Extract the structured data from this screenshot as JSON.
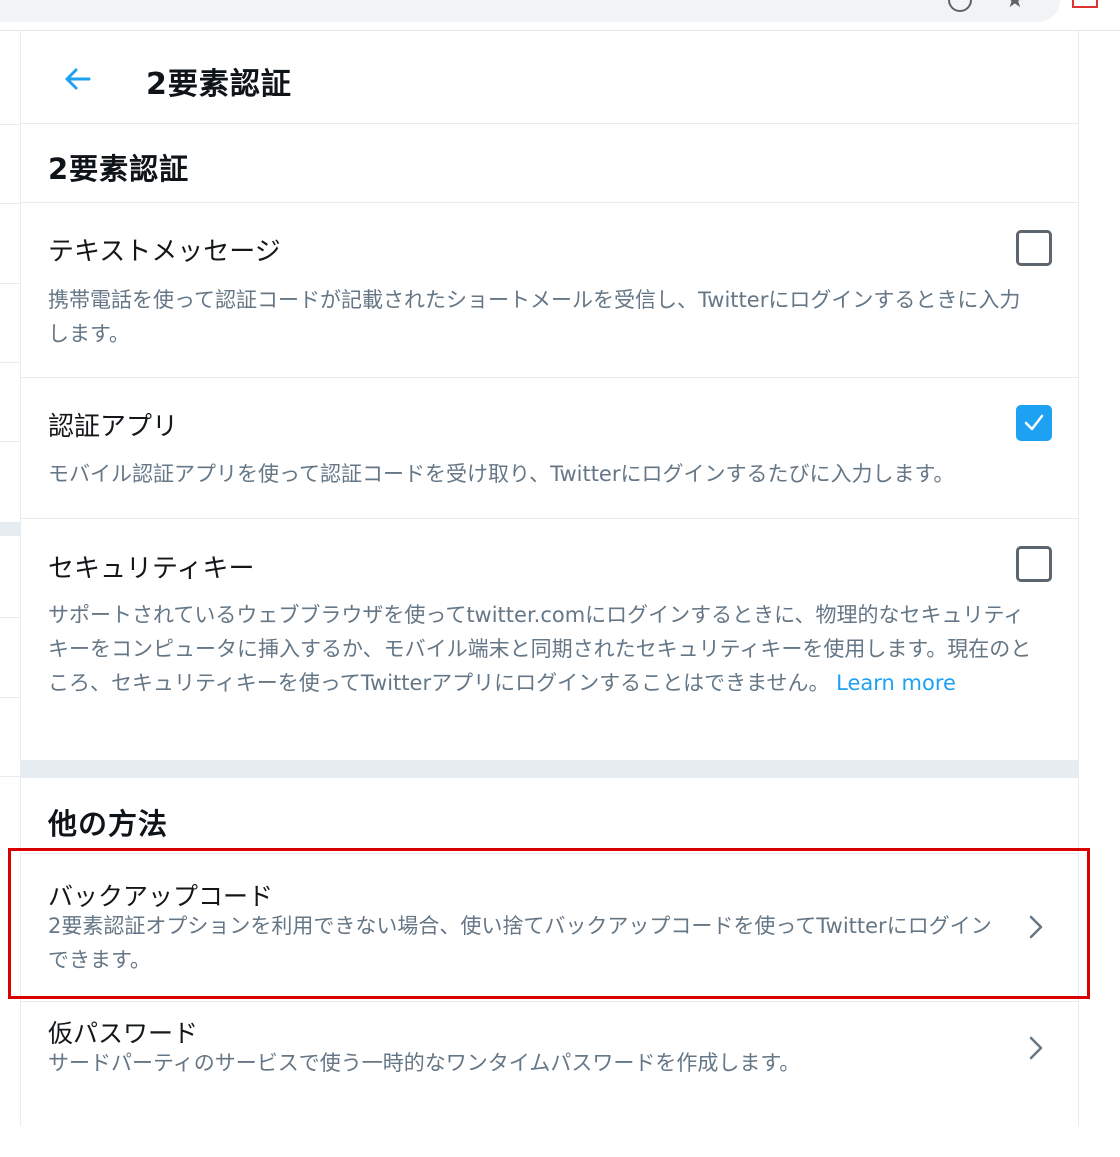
{
  "header": {
    "title": "2要素認証",
    "back_icon": "arrow-left-icon"
  },
  "two_factor": {
    "section_title": "2要素認証",
    "options": [
      {
        "label": "テキストメッセージ",
        "description": "携帯電話を使って認証コードが記載されたショートメールを受信し、Twitterにログインするときに入力します。",
        "checked": false
      },
      {
        "label": "認証アプリ",
        "description": "モバイル認証アプリを使って認証コードを受け取り、Twitterにログインするたびに入力します。",
        "checked": true
      },
      {
        "label": "セキュリティキー",
        "description": "サポートされているウェブブラウザを使ってtwitter.comにログインするときに、物理的なセキュリティキーをコンピュータに挿入するか、モバイル端末と同期されたセキュリティキーを使用します。現在のところ、セキュリティキーを使ってTwitterアプリにログインすることはできません。",
        "learn_more": "Learn more",
        "checked": false
      }
    ]
  },
  "other_methods": {
    "section_title": "他の方法",
    "items": [
      {
        "label": "バックアップコード",
        "description": "2要素認証オプションを利用できない場合、使い捨てバックアップコードを使ってTwitterにログインできます。"
      },
      {
        "label": "仮パスワード",
        "description": "サードパーティのサービスで使う一時的なワンタイムパスワードを作成します。"
      }
    ]
  },
  "colors": {
    "accent": "#1da1f2",
    "highlight": "#d80000",
    "secondary_text": "#657786",
    "border": "#e6ecf0"
  }
}
